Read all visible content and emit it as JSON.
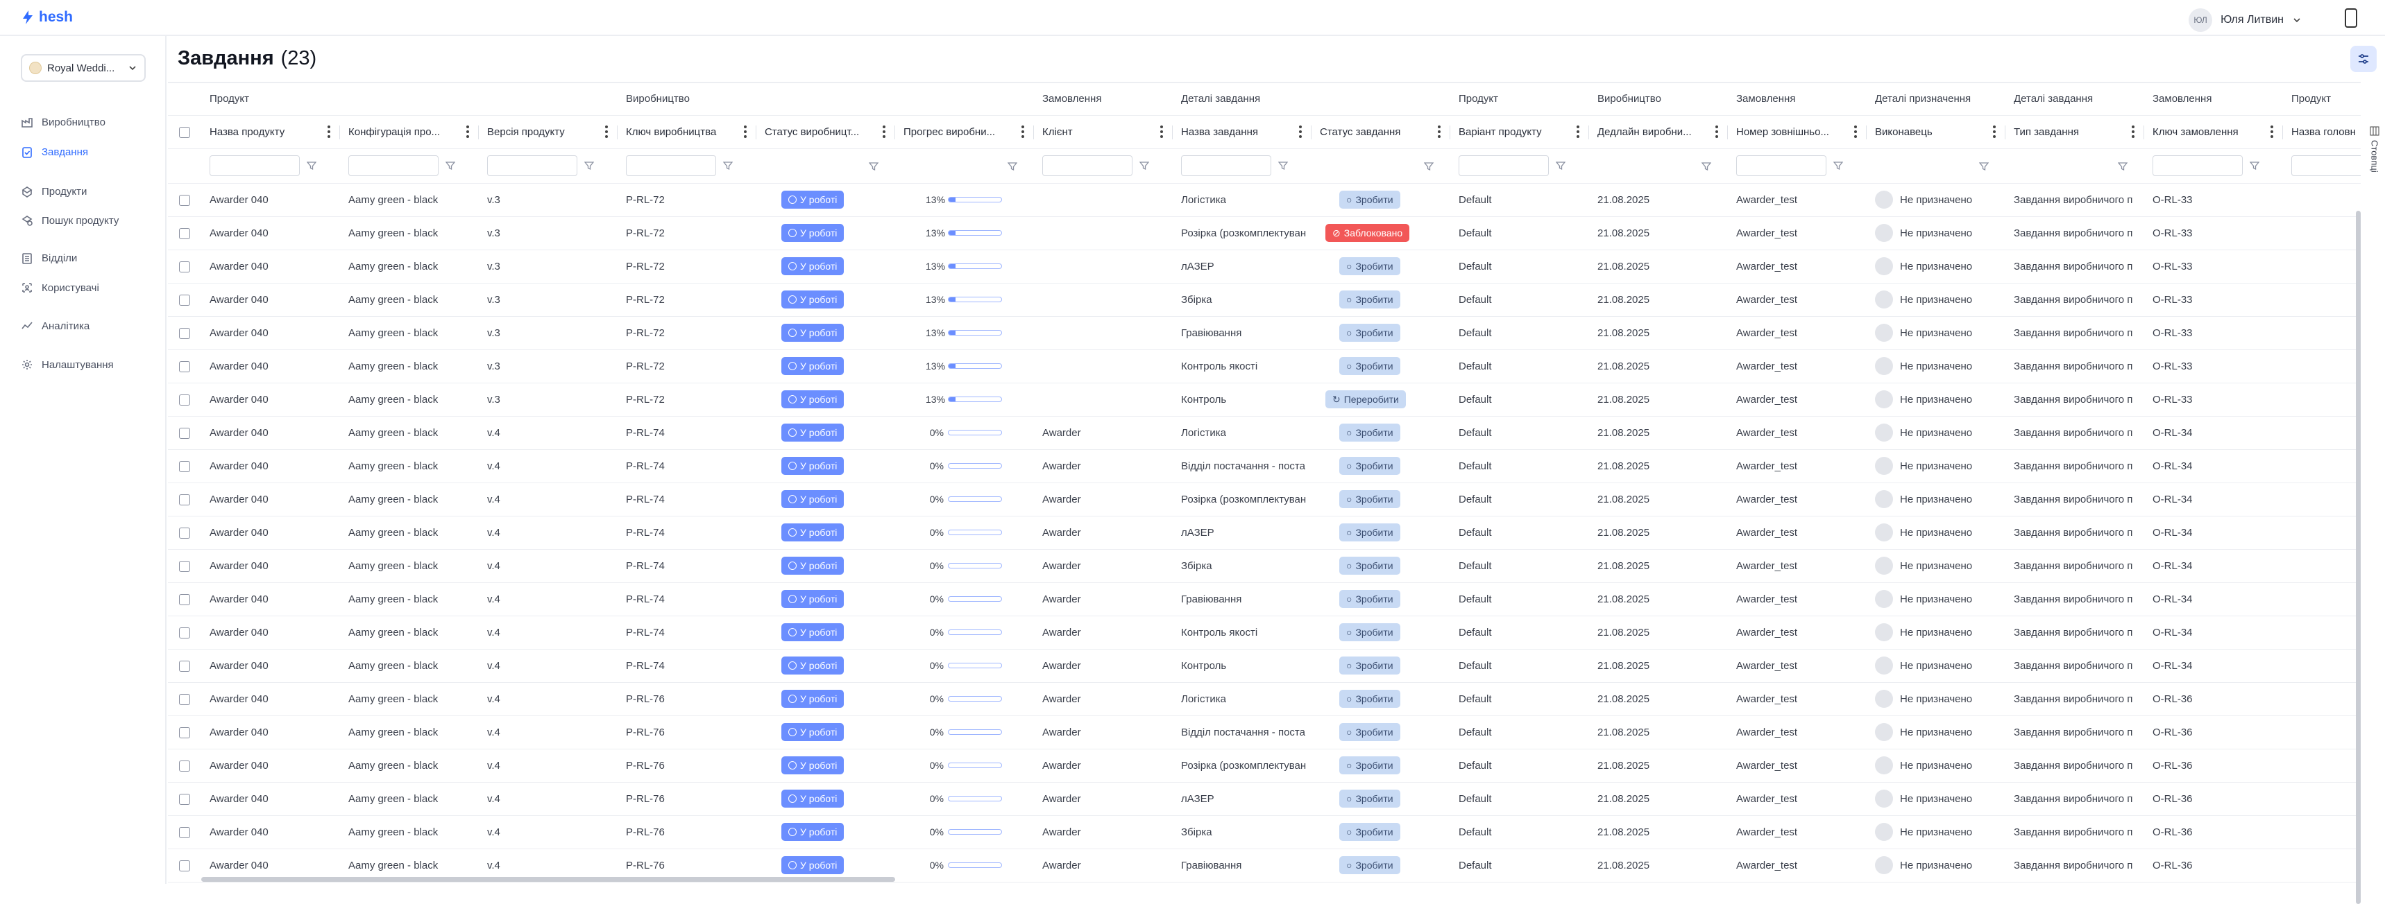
{
  "app": {
    "logo_text": "hesh",
    "user_initials": "ЮЛ",
    "user_name": "Юля Литвин"
  },
  "workspace": {
    "name": "Royal Weddi..."
  },
  "nav": [
    {
      "label": "Виробництво",
      "icon": "factory-icon",
      "active": false
    },
    {
      "label": "Завдання",
      "icon": "clipboard-check-icon",
      "active": true
    },
    {
      "label": "Продукти",
      "icon": "products-icon",
      "active": false
    },
    {
      "label": "Пошук продукту",
      "icon": "search-product-icon",
      "active": false
    },
    {
      "label": "Відділи",
      "icon": "departments-icon",
      "active": false
    },
    {
      "label": "Користувачі",
      "icon": "users-icon",
      "active": false
    },
    {
      "label": "Аналітика",
      "icon": "analytics-icon",
      "active": false
    },
    {
      "label": "Налаштування",
      "icon": "gear-icon",
      "active": false
    }
  ],
  "page": {
    "title": "Завдання",
    "count": "(23)",
    "columns_tab": "Стовпці"
  },
  "groups": [
    "Продукт",
    "",
    "",
    "Виробництво",
    "",
    "",
    "Замовлення",
    "Деталі завдання",
    "",
    "Продукт",
    "Виробництво",
    "Замовлення",
    "Деталі призначення",
    "Деталі завдання",
    "Замовлення",
    "Продукт"
  ],
  "columns": [
    "Назва продукту",
    "Конфігурація про...",
    "Версія продукту",
    "Ключ виробництва",
    "Статус виробницт...",
    "Прогрес виробни...",
    "Клієнт",
    "Назва завдання",
    "Статус завдання",
    "Варіант продукту",
    "Дедлайн виробни...",
    "Номер зовнішньо...",
    "Виконавець",
    "Тип завдання",
    "Ключ замовлення",
    "Назва головн"
  ],
  "rows": [
    {
      "product": "Awarder 040",
      "config": "Aamy green - black",
      "version": "v.3",
      "key": "P-RL-72",
      "prod_status": "У роботі",
      "progress": "13%",
      "progress_value": 0.13,
      "client": "",
      "task": "Логістика",
      "task_status": "Зробити",
      "task_status_kind": "todo",
      "variant": "Default",
      "deadline": "21.08.2025",
      "ext_num": "Awarder_test",
      "assignee": "Не призначено",
      "task_type": "Завдання виробничого п",
      "order_key": "O-RL-33"
    },
    {
      "product": "Awarder 040",
      "config": "Aamy green - black",
      "version": "v.3",
      "key": "P-RL-72",
      "prod_status": "У роботі",
      "progress": "13%",
      "progress_value": 0.13,
      "client": "",
      "task": "Розірка (розкомплектуван",
      "task_status": "Заблоковано",
      "task_status_kind": "block",
      "variant": "Default",
      "deadline": "21.08.2025",
      "ext_num": "Awarder_test",
      "assignee": "Не призначено",
      "task_type": "Завдання виробничого п",
      "order_key": "O-RL-33"
    },
    {
      "product": "Awarder 040",
      "config": "Aamy green - black",
      "version": "v.3",
      "key": "P-RL-72",
      "prod_status": "У роботі",
      "progress": "13%",
      "progress_value": 0.13,
      "client": "",
      "task": "лАЗЕР",
      "task_status": "Зробити",
      "task_status_kind": "todo",
      "variant": "Default",
      "deadline": "21.08.2025",
      "ext_num": "Awarder_test",
      "assignee": "Не призначено",
      "task_type": "Завдання виробничого п",
      "order_key": "O-RL-33"
    },
    {
      "product": "Awarder 040",
      "config": "Aamy green - black",
      "version": "v.3",
      "key": "P-RL-72",
      "prod_status": "У роботі",
      "progress": "13%",
      "progress_value": 0.13,
      "client": "",
      "task": "Збірка",
      "task_status": "Зробити",
      "task_status_kind": "todo",
      "variant": "Default",
      "deadline": "21.08.2025",
      "ext_num": "Awarder_test",
      "assignee": "Не призначено",
      "task_type": "Завдання виробничого п",
      "order_key": "O-RL-33"
    },
    {
      "product": "Awarder 040",
      "config": "Aamy green - black",
      "version": "v.3",
      "key": "P-RL-72",
      "prod_status": "У роботі",
      "progress": "13%",
      "progress_value": 0.13,
      "client": "",
      "task": "Гравіювання",
      "task_status": "Зробити",
      "task_status_kind": "todo",
      "variant": "Default",
      "deadline": "21.08.2025",
      "ext_num": "Awarder_test",
      "assignee": "Не призначено",
      "task_type": "Завдання виробничого п",
      "order_key": "O-RL-33"
    },
    {
      "product": "Awarder 040",
      "config": "Aamy green - black",
      "version": "v.3",
      "key": "P-RL-72",
      "prod_status": "У роботі",
      "progress": "13%",
      "progress_value": 0.13,
      "client": "",
      "task": "Контроль якості",
      "task_status": "Зробити",
      "task_status_kind": "todo",
      "variant": "Default",
      "deadline": "21.08.2025",
      "ext_num": "Awarder_test",
      "assignee": "Не призначено",
      "task_type": "Завдання виробничого п",
      "order_key": "O-RL-33"
    },
    {
      "product": "Awarder 040",
      "config": "Aamy green - black",
      "version": "v.3",
      "key": "P-RL-72",
      "prod_status": "У роботі",
      "progress": "13%",
      "progress_value": 0.13,
      "client": "",
      "task": "Контроль",
      "task_status": "Переробити",
      "task_status_kind": "redo",
      "variant": "Default",
      "deadline": "21.08.2025",
      "ext_num": "Awarder_test",
      "assignee": "Не призначено",
      "task_type": "Завдання виробничого п",
      "order_key": "O-RL-33"
    },
    {
      "product": "Awarder 040",
      "config": "Aamy green - black",
      "version": "v.4",
      "key": "P-RL-74",
      "prod_status": "У роботі",
      "progress": "0%",
      "progress_value": 0,
      "client": "Awarder",
      "task": "Логістика",
      "task_status": "Зробити",
      "task_status_kind": "todo",
      "variant": "Default",
      "deadline": "21.08.2025",
      "ext_num": "Awarder_test",
      "assignee": "Не призначено",
      "task_type": "Завдання виробничого п",
      "order_key": "O-RL-34"
    },
    {
      "product": "Awarder 040",
      "config": "Aamy green - black",
      "version": "v.4",
      "key": "P-RL-74",
      "prod_status": "У роботі",
      "progress": "0%",
      "progress_value": 0,
      "client": "Awarder",
      "task": "Відділ постачання - поста",
      "task_status": "Зробити",
      "task_status_kind": "todo",
      "variant": "Default",
      "deadline": "21.08.2025",
      "ext_num": "Awarder_test",
      "assignee": "Не призначено",
      "task_type": "Завдання виробничого п",
      "order_key": "O-RL-34"
    },
    {
      "product": "Awarder 040",
      "config": "Aamy green - black",
      "version": "v.4",
      "key": "P-RL-74",
      "prod_status": "У роботі",
      "progress": "0%",
      "progress_value": 0,
      "client": "Awarder",
      "task": "Розірка (розкомплектуван",
      "task_status": "Зробити",
      "task_status_kind": "todo",
      "variant": "Default",
      "deadline": "21.08.2025",
      "ext_num": "Awarder_test",
      "assignee": "Не призначено",
      "task_type": "Завдання виробничого п",
      "order_key": "O-RL-34"
    },
    {
      "product": "Awarder 040",
      "config": "Aamy green - black",
      "version": "v.4",
      "key": "P-RL-74",
      "prod_status": "У роботі",
      "progress": "0%",
      "progress_value": 0,
      "client": "Awarder",
      "task": "лАЗЕР",
      "task_status": "Зробити",
      "task_status_kind": "todo",
      "variant": "Default",
      "deadline": "21.08.2025",
      "ext_num": "Awarder_test",
      "assignee": "Не призначено",
      "task_type": "Завдання виробничого п",
      "order_key": "O-RL-34"
    },
    {
      "product": "Awarder 040",
      "config": "Aamy green - black",
      "version": "v.4",
      "key": "P-RL-74",
      "prod_status": "У роботі",
      "progress": "0%",
      "progress_value": 0,
      "client": "Awarder",
      "task": "Збірка",
      "task_status": "Зробити",
      "task_status_kind": "todo",
      "variant": "Default",
      "deadline": "21.08.2025",
      "ext_num": "Awarder_test",
      "assignee": "Не призначено",
      "task_type": "Завдання виробничого п",
      "order_key": "O-RL-34"
    },
    {
      "product": "Awarder 040",
      "config": "Aamy green - black",
      "version": "v.4",
      "key": "P-RL-74",
      "prod_status": "У роботі",
      "progress": "0%",
      "progress_value": 0,
      "client": "Awarder",
      "task": "Гравіювання",
      "task_status": "Зробити",
      "task_status_kind": "todo",
      "variant": "Default",
      "deadline": "21.08.2025",
      "ext_num": "Awarder_test",
      "assignee": "Не призначено",
      "task_type": "Завдання виробничого п",
      "order_key": "O-RL-34"
    },
    {
      "product": "Awarder 040",
      "config": "Aamy green - black",
      "version": "v.4",
      "key": "P-RL-74",
      "prod_status": "У роботі",
      "progress": "0%",
      "progress_value": 0,
      "client": "Awarder",
      "task": "Контроль якості",
      "task_status": "Зробити",
      "task_status_kind": "todo",
      "variant": "Default",
      "deadline": "21.08.2025",
      "ext_num": "Awarder_test",
      "assignee": "Не призначено",
      "task_type": "Завдання виробничого п",
      "order_key": "O-RL-34"
    },
    {
      "product": "Awarder 040",
      "config": "Aamy green - black",
      "version": "v.4",
      "key": "P-RL-74",
      "prod_status": "У роботі",
      "progress": "0%",
      "progress_value": 0,
      "client": "Awarder",
      "task": "Контроль",
      "task_status": "Зробити",
      "task_status_kind": "todo",
      "variant": "Default",
      "deadline": "21.08.2025",
      "ext_num": "Awarder_test",
      "assignee": "Не призначено",
      "task_type": "Завдання виробничого п",
      "order_key": "O-RL-34"
    },
    {
      "product": "Awarder 040",
      "config": "Aamy green - black",
      "version": "v.4",
      "key": "P-RL-76",
      "prod_status": "У роботі",
      "progress": "0%",
      "progress_value": 0,
      "client": "Awarder",
      "task": "Логістика",
      "task_status": "Зробити",
      "task_status_kind": "todo",
      "variant": "Default",
      "deadline": "21.08.2025",
      "ext_num": "Awarder_test",
      "assignee": "Не призначено",
      "task_type": "Завдання виробничого п",
      "order_key": "O-RL-36"
    },
    {
      "product": "Awarder 040",
      "config": "Aamy green - black",
      "version": "v.4",
      "key": "P-RL-76",
      "prod_status": "У роботі",
      "progress": "0%",
      "progress_value": 0,
      "client": "Awarder",
      "task": "Відділ постачання - поста",
      "task_status": "Зробити",
      "task_status_kind": "todo",
      "variant": "Default",
      "deadline": "21.08.2025",
      "ext_num": "Awarder_test",
      "assignee": "Не призначено",
      "task_type": "Завдання виробничого п",
      "order_key": "O-RL-36"
    },
    {
      "product": "Awarder 040",
      "config": "Aamy green - black",
      "version": "v.4",
      "key": "P-RL-76",
      "prod_status": "У роботі",
      "progress": "0%",
      "progress_value": 0,
      "client": "Awarder",
      "task": "Розірка (розкомплектуван",
      "task_status": "Зробити",
      "task_status_kind": "todo",
      "variant": "Default",
      "deadline": "21.08.2025",
      "ext_num": "Awarder_test",
      "assignee": "Не призначено",
      "task_type": "Завдання виробничого п",
      "order_key": "O-RL-36"
    },
    {
      "product": "Awarder 040",
      "config": "Aamy green - black",
      "version": "v.4",
      "key": "P-RL-76",
      "prod_status": "У роботі",
      "progress": "0%",
      "progress_value": 0,
      "client": "Awarder",
      "task": "лАЗЕР",
      "task_status": "Зробити",
      "task_status_kind": "todo",
      "variant": "Default",
      "deadline": "21.08.2025",
      "ext_num": "Awarder_test",
      "assignee": "Не призначено",
      "task_type": "Завдання виробничого п",
      "order_key": "O-RL-36"
    },
    {
      "product": "Awarder 040",
      "config": "Aamy green - black",
      "version": "v.4",
      "key": "P-RL-76",
      "prod_status": "У роботі",
      "progress": "0%",
      "progress_value": 0,
      "client": "Awarder",
      "task": "Збірка",
      "task_status": "Зробити",
      "task_status_kind": "todo",
      "variant": "Default",
      "deadline": "21.08.2025",
      "ext_num": "Awarder_test",
      "assignee": "Не призначено",
      "task_type": "Завдання виробничого п",
      "order_key": "O-RL-36"
    },
    {
      "product": "Awarder 040",
      "config": "Aamy green - black",
      "version": "v.4",
      "key": "P-RL-76",
      "prod_status": "У роботі",
      "progress": "0%",
      "progress_value": 0,
      "client": "Awarder",
      "task": "Гравіювання",
      "task_status": "Зробити",
      "task_status_kind": "todo",
      "variant": "Default",
      "deadline": "21.08.2025",
      "ext_num": "Awarder_test",
      "assignee": "Не призначено",
      "task_type": "Завдання виробничого п",
      "order_key": "O-RL-36"
    }
  ]
}
